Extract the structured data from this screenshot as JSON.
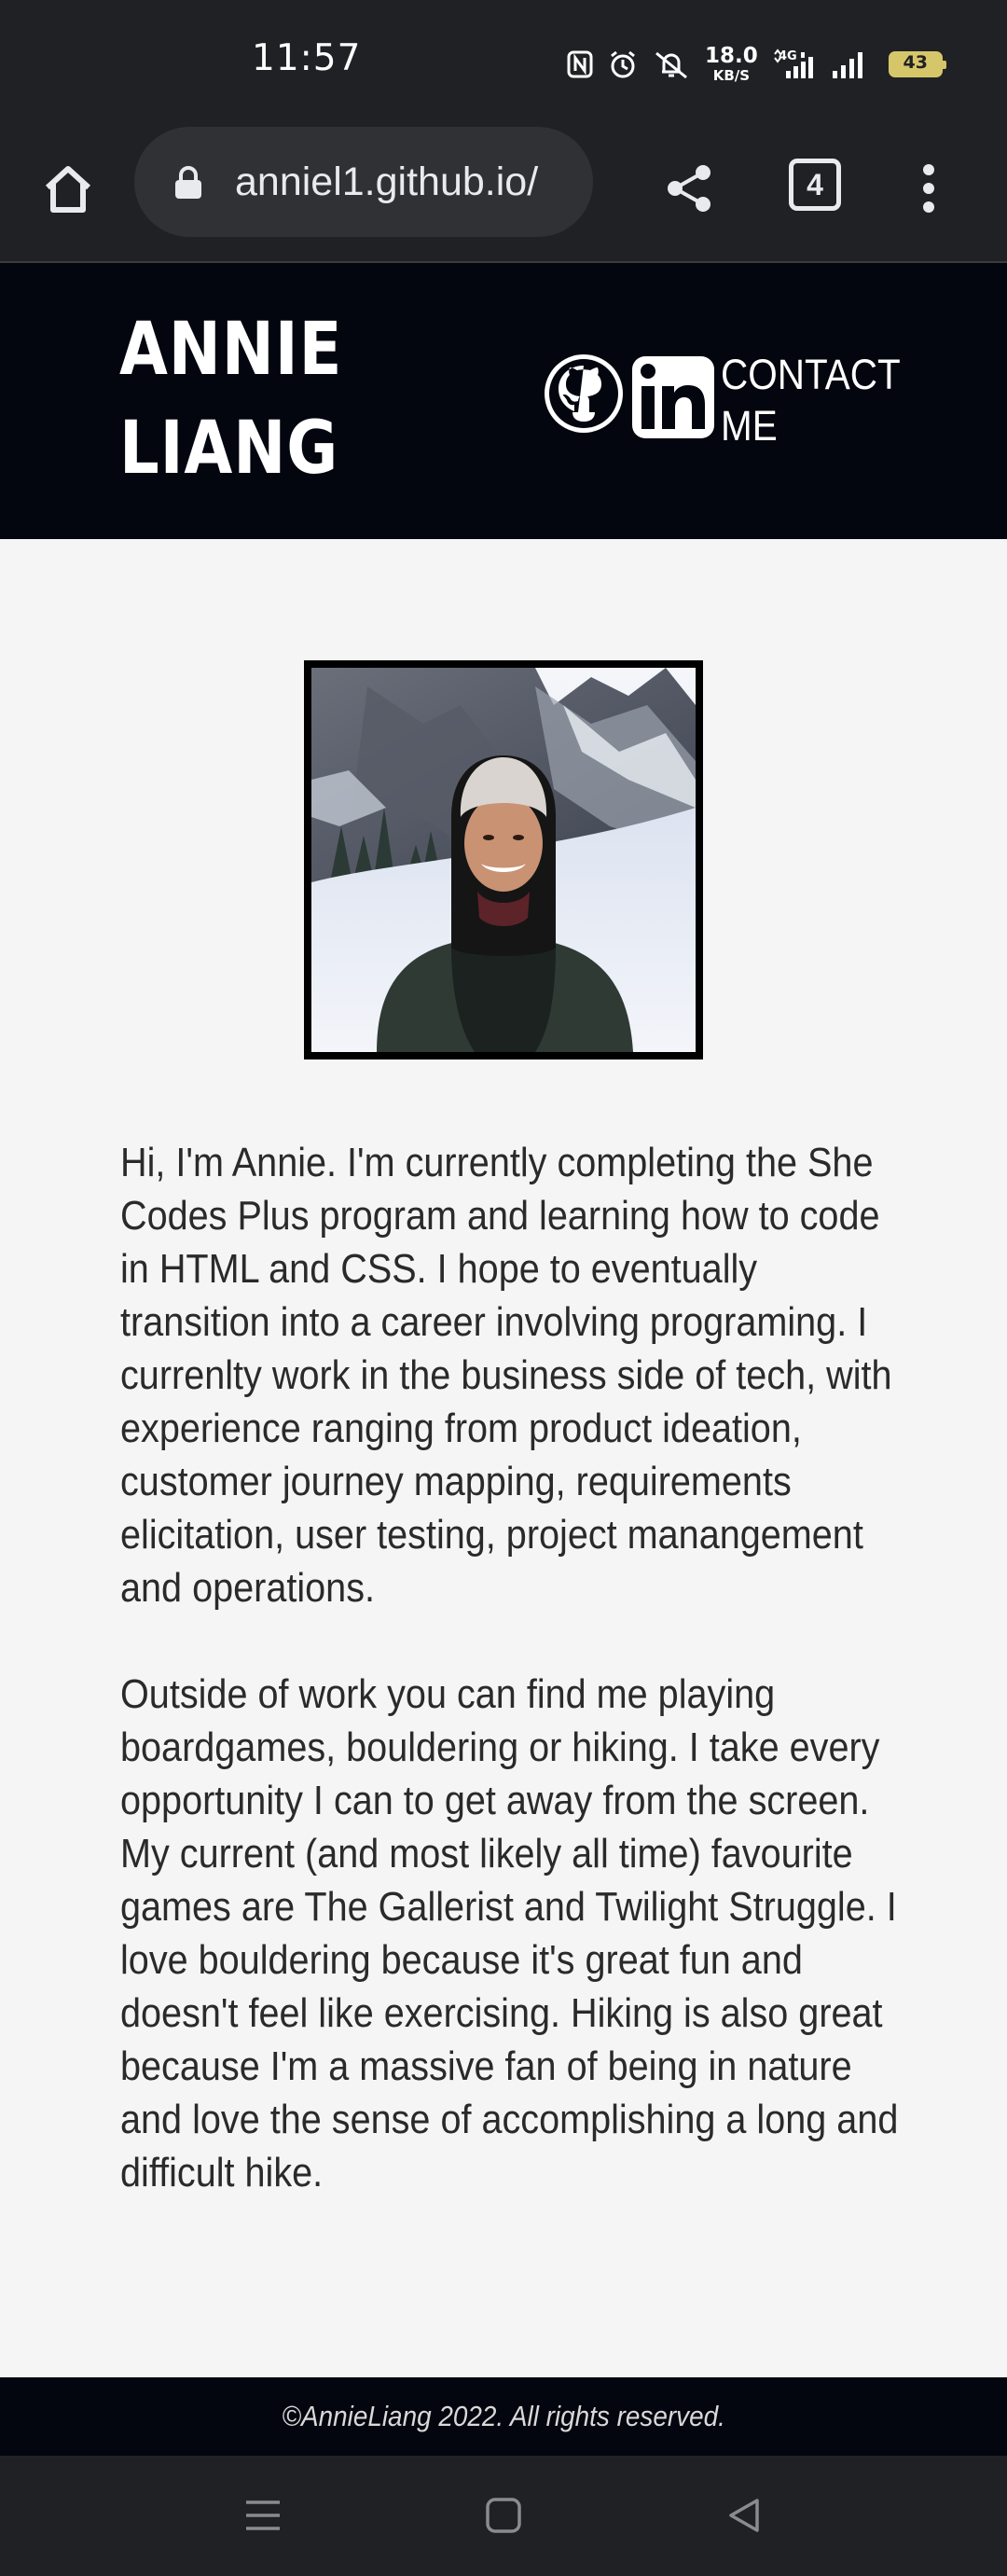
{
  "status_bar": {
    "time": "11:57",
    "net_speed_value": "18.0",
    "net_speed_unit": "KB/S",
    "network_type": "4G",
    "battery_level": "43",
    "icons": [
      "nfc-icon",
      "alarm-icon",
      "silent-icon",
      "signal-4g-icon",
      "signal-icon",
      "battery-icon"
    ],
    "battery_color": "#d6c66a"
  },
  "browser": {
    "url": "anniel1.github.io/",
    "tab_count": "4",
    "icons": [
      "home-icon",
      "lock-icon",
      "share-icon",
      "tabs-icon",
      "more-vert-icon"
    ]
  },
  "header": {
    "name_line1": "ANNIE",
    "name_line2": "LIANG",
    "github_label": "GitHub",
    "linkedin_label": "in",
    "contact_line1": "CONTACT",
    "contact_line2": "ME",
    "background_color": "#03050f"
  },
  "main": {
    "photo_alt": "Annie in the snowy mountains",
    "paragraphs": [
      "Hi, I'm Annie. I'm currently completing the She Codes Plus program and learning how to code in HTML and CSS. I hope to eventually transition into a career involving programing. I currenlty work in the business side of tech, with experience ranging from product ideation, customer journey mapping, requirements elicitation, user testing, project manangement and operations.",
      "Outside of work you can find me playing boardgames, bouldering or hiking. I take every opportunity I can to get away from the screen. My current (and most likely all time) favourite games are The Gallerist and Twilight Struggle. I love bouldering because it's great fun and doesn't feel like exercising. Hiking is also great because I'm a massive fan of being in nature and love the sense of accomplishing a long and difficult hike."
    ]
  },
  "footer": {
    "copyright": "©AnnieLiang 2022. All rights reserved."
  },
  "nav_bar": {
    "icons": [
      "menu-icon",
      "home-square-icon",
      "back-icon"
    ]
  }
}
